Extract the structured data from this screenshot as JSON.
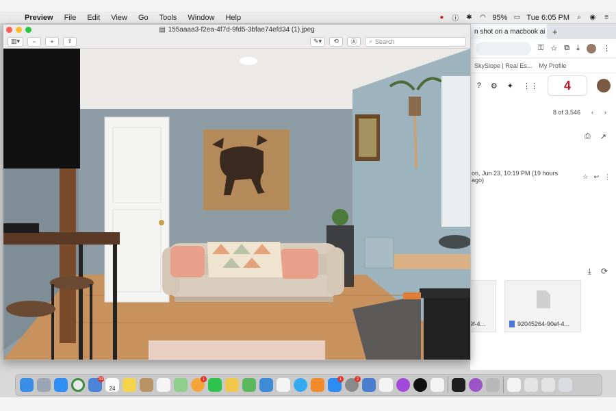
{
  "menubar": {
    "app_name": "Preview",
    "menus": [
      "File",
      "Edit",
      "View",
      "Go",
      "Tools",
      "Window",
      "Help"
    ],
    "battery": "95%",
    "clock": "Tue 6:05 PM"
  },
  "preview": {
    "filename": "155aaaa3-f2ea-4f7d-9fd5-3bfae74efd34 (1).jpeg",
    "search_placeholder": "Search"
  },
  "chrome": {
    "tab_title": "n shot on a macbook ai",
    "bookmarks": [
      "SkySlope | Real Es...",
      "My Profile"
    ],
    "logo_text": "4",
    "message_count": "8 of 3,546",
    "date_text": "on, Jun 23, 10:19 PM (19 hours ago)",
    "attachment_left": "9f-4...",
    "attachment_right": "92045264-90ef-4..."
  },
  "dock": {
    "calendar_day": "24",
    "badges": {
      "mail": "33",
      "photos": "1",
      "appstore": "1",
      "settings": "2"
    }
  },
  "colors": {
    "wall": "#8fa0a7",
    "floor": "#c8925e",
    "couch": "#d9cdbd",
    "pillow": "#e8a08a",
    "board": "#b48a5a",
    "moose": "#3b2a1f"
  }
}
